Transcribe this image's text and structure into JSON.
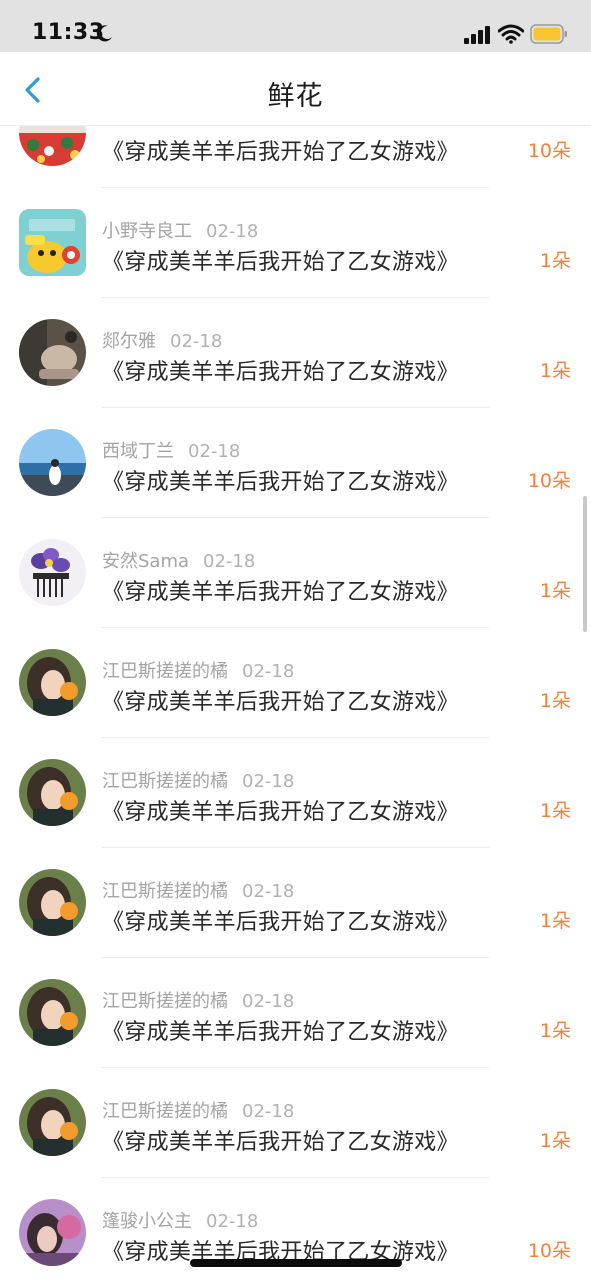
{
  "status_bar": {
    "time": "11:33",
    "icons": [
      "moon-icon",
      "signal-icon",
      "wifi-icon",
      "battery-icon"
    ],
    "battery_color": "#f7c531"
  },
  "nav": {
    "back_icon": "chevron-left-icon",
    "title": "鲜花",
    "accent": "#2e9bdc"
  },
  "colors": {
    "amount": "#f2823c",
    "meta": "#a4a4a4",
    "title": "#2a2a2a"
  },
  "rows": [
    {
      "user": "",
      "date": "",
      "book": "《穿成美羊羊后我开始了乙女游戏》",
      "amount": "10朵",
      "avatar": "red-floral-avatar"
    },
    {
      "user": "小野寺良工",
      "date": "02-18",
      "book": "《穿成美羊羊后我开始了乙女游戏》",
      "amount": "1朵",
      "avatar": "yellow-cartoon-avatar"
    },
    {
      "user": "郯尔雅",
      "date": "02-18",
      "book": "《穿成美羊羊后我开始了乙女游戏》",
      "amount": "1朵",
      "avatar": "hand-photo-avatar"
    },
    {
      "user": "西域丁兰",
      "date": "02-18",
      "book": "《穿成美羊羊后我开始了乙女游戏》",
      "amount": "10朵",
      "avatar": "seaside-avatar"
    },
    {
      "user": "安然Sama",
      "date": "02-18",
      "book": "《穿成美羊羊后我开始了乙女游戏》",
      "amount": "1朵",
      "avatar": "purple-flower-avatar"
    },
    {
      "user": "江巴斯搓搓的橘",
      "date": "02-18",
      "book": "《穿成美羊羊后我开始了乙女游戏》",
      "amount": "1朵",
      "avatar": "girl-orange-avatar"
    },
    {
      "user": "江巴斯搓搓的橘",
      "date": "02-18",
      "book": "《穿成美羊羊后我开始了乙女游戏》",
      "amount": "1朵",
      "avatar": "girl-orange-avatar"
    },
    {
      "user": "江巴斯搓搓的橘",
      "date": "02-18",
      "book": "《穿成美羊羊后我开始了乙女游戏》",
      "amount": "1朵",
      "avatar": "girl-orange-avatar"
    },
    {
      "user": "江巴斯搓搓的橘",
      "date": "02-18",
      "book": "《穿成美羊羊后我开始了乙女游戏》",
      "amount": "1朵",
      "avatar": "girl-orange-avatar"
    },
    {
      "user": "江巴斯搓搓的橘",
      "date": "02-18",
      "book": "《穿成美羊羊后我开始了乙女游戏》",
      "amount": "1朵",
      "avatar": "girl-orange-avatar"
    },
    {
      "user": "篷骏小公主",
      "date": "02-18",
      "book": "《穿成美羊羊后我开始了乙女游戏》",
      "amount": "10朵",
      "avatar": "purple-portrait-avatar"
    }
  ]
}
